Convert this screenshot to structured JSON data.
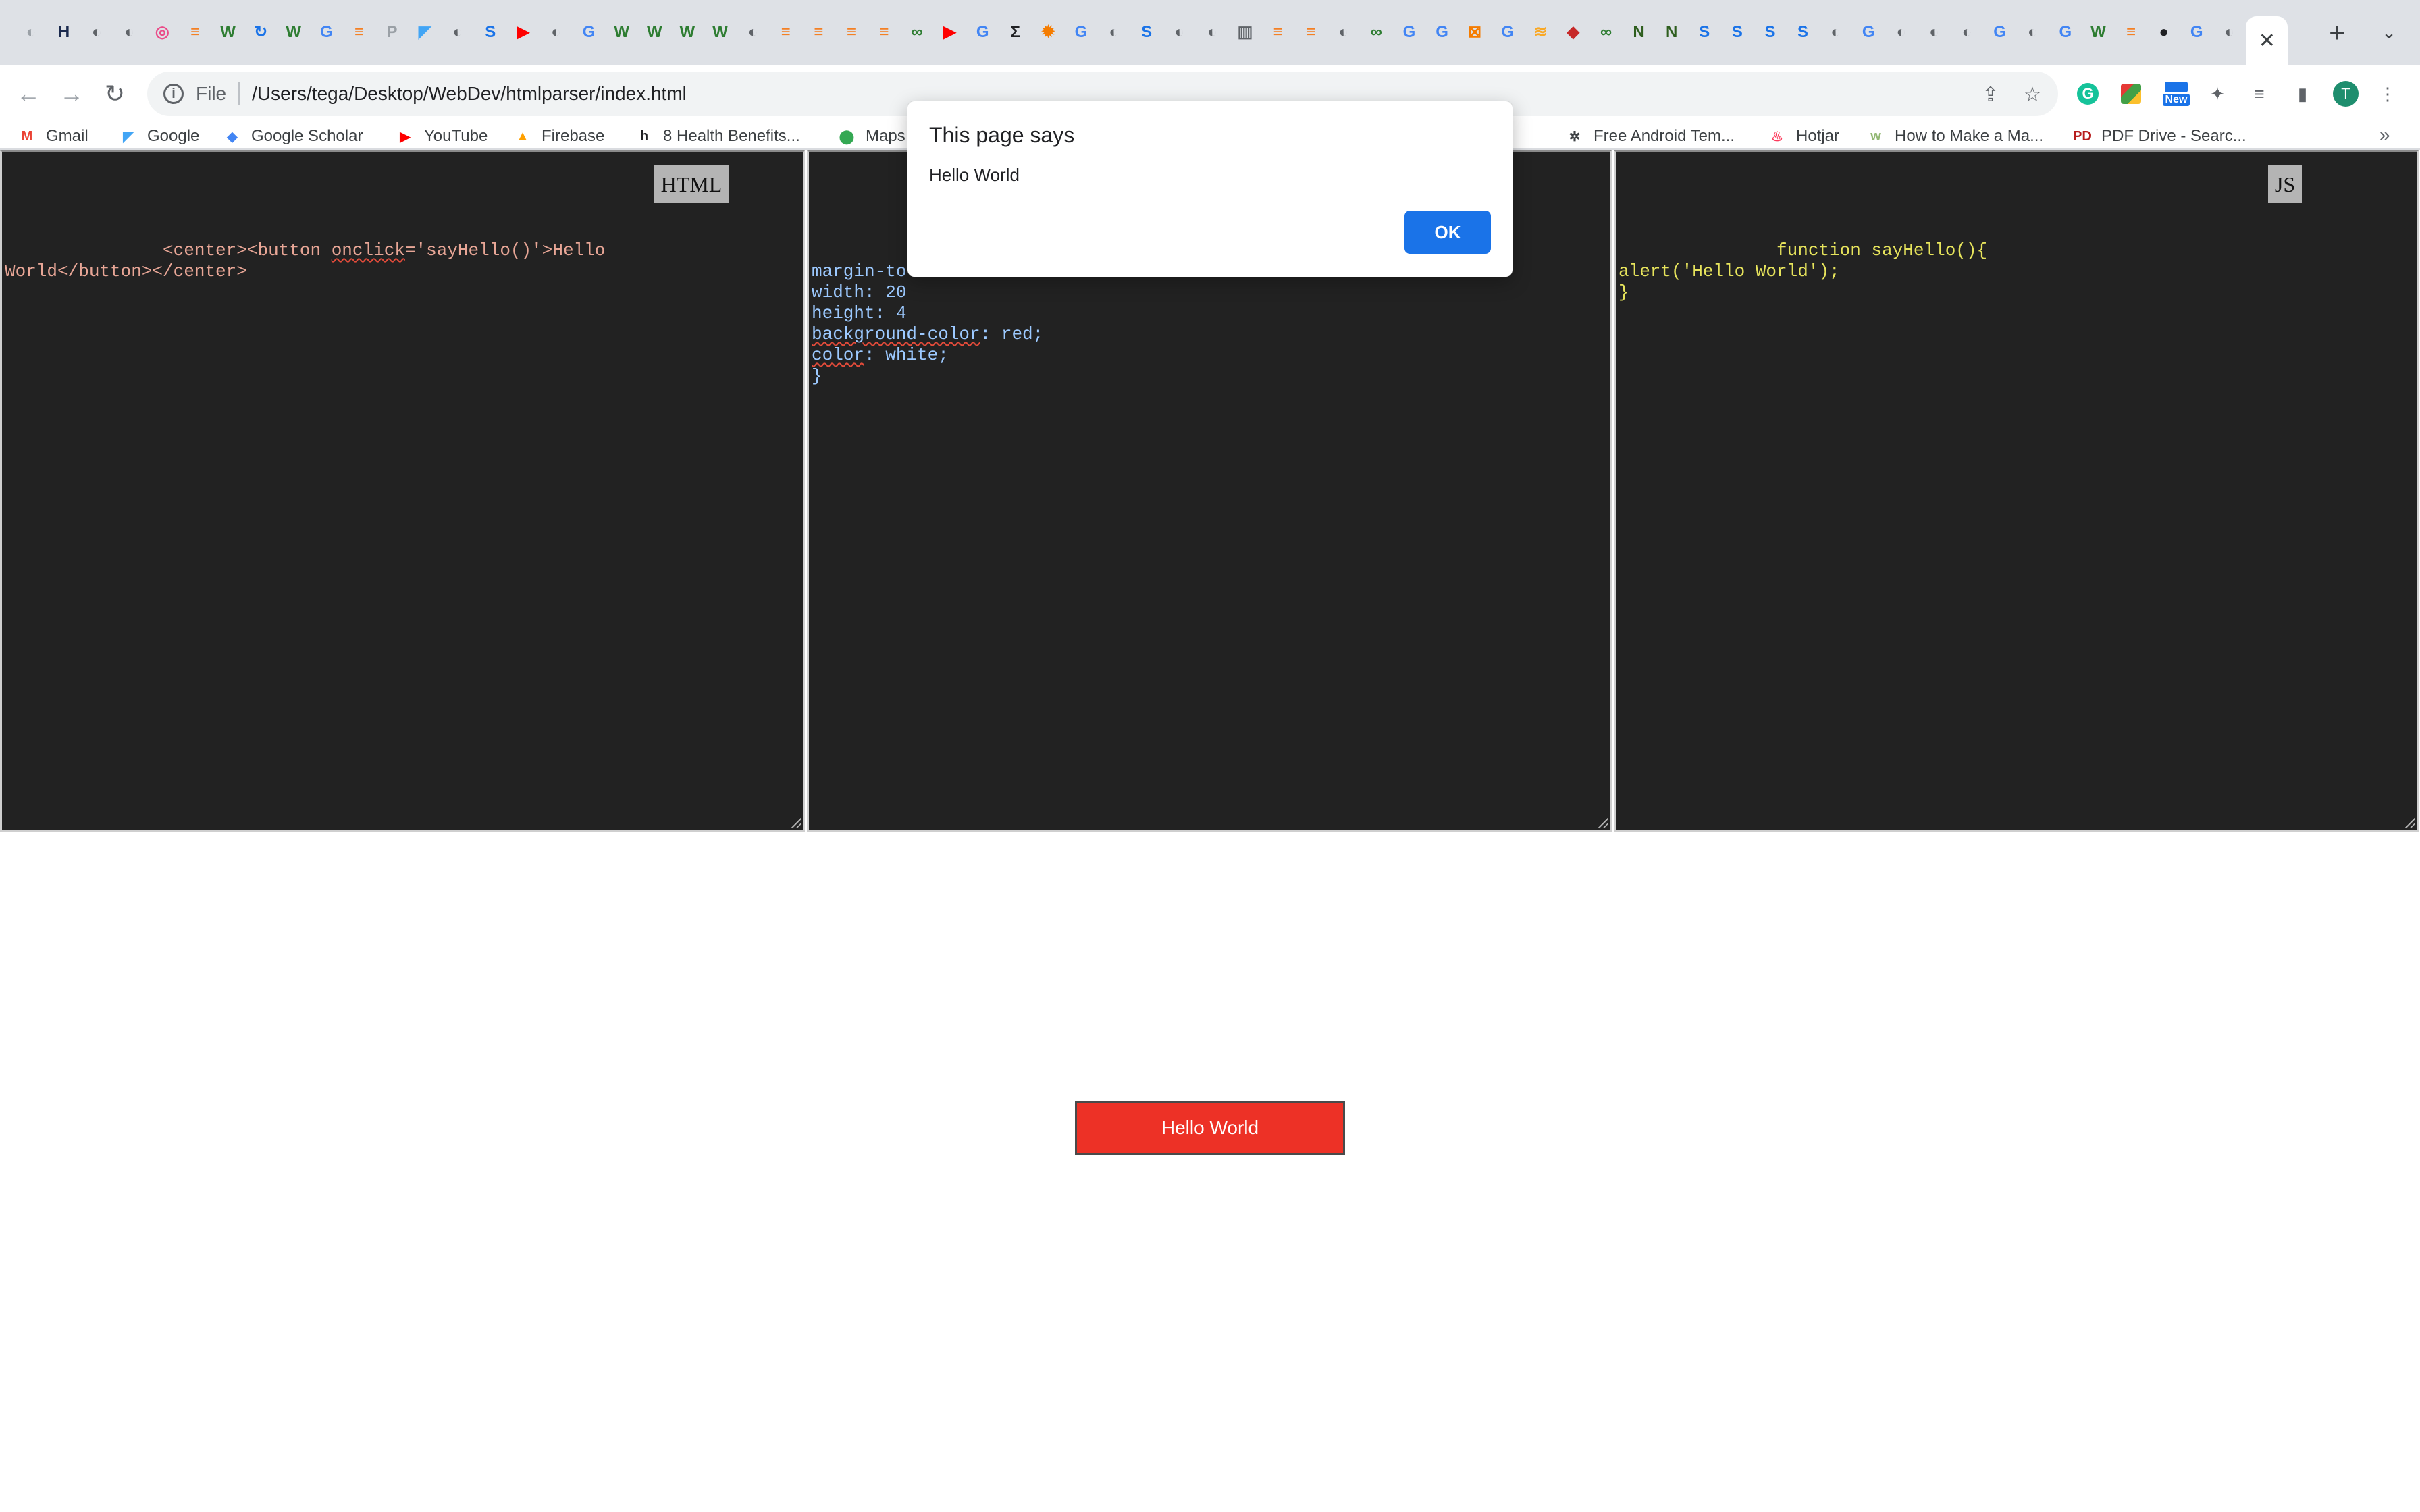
{
  "browser": {
    "active_tab_close": "✕",
    "new_tab": "+",
    "tab_search": "⌄",
    "tab_favicons": [
      {
        "icon": "globe-icon",
        "glyph": "◐",
        "color": "#9aa0a6"
      },
      {
        "icon": "hud-icon",
        "glyph": "H",
        "color": "#1b2a4e"
      },
      {
        "icon": "globe-icon",
        "glyph": "◐",
        "color": "#5f6368"
      },
      {
        "icon": "globe-icon",
        "glyph": "◐",
        "color": "#5f6368"
      },
      {
        "icon": "dribbble-icon",
        "glyph": "◎",
        "color": "#ea4c89"
      },
      {
        "icon": "stackoverflow-icon",
        "glyph": "≡",
        "color": "#f48024"
      },
      {
        "icon": "webflow-icon",
        "glyph": "W",
        "color": "#2e7d32"
      },
      {
        "icon": "refresh-logo-icon",
        "glyph": "↻",
        "color": "#1a73e8"
      },
      {
        "icon": "webflow-icon",
        "glyph": "W",
        "color": "#2e7d32"
      },
      {
        "icon": "google-icon",
        "glyph": "G",
        "color": "#4285f4"
      },
      {
        "icon": "stackoverflow-icon",
        "glyph": "≡",
        "color": "#f48024"
      },
      {
        "icon": "pinterest-icon",
        "glyph": "P",
        "color": "#9aa0a6"
      },
      {
        "icon": "flutter-icon",
        "glyph": "◤",
        "color": "#42a5f5"
      },
      {
        "icon": "globe-icon",
        "glyph": "◐",
        "color": "#5f6368"
      },
      {
        "icon": "s-icon",
        "glyph": "S",
        "color": "#1a73e8"
      },
      {
        "icon": "youtube-icon",
        "glyph": "▶",
        "color": "#ff0000"
      },
      {
        "icon": "globe-icon",
        "glyph": "◐",
        "color": "#5f6368"
      },
      {
        "icon": "google-icon",
        "glyph": "G",
        "color": "#4285f4"
      },
      {
        "icon": "webflow-icon",
        "glyph": "W",
        "color": "#2e7d32"
      },
      {
        "icon": "webflow-icon",
        "glyph": "W",
        "color": "#2e7d32"
      },
      {
        "icon": "webflow-icon",
        "glyph": "W",
        "color": "#2e7d32"
      },
      {
        "icon": "webflow-icon",
        "glyph": "W",
        "color": "#2e7d32"
      },
      {
        "icon": "globe-icon",
        "glyph": "◐",
        "color": "#5f6368"
      },
      {
        "icon": "stackoverflow-icon",
        "glyph": "≡",
        "color": "#f48024"
      },
      {
        "icon": "stackoverflow-icon",
        "glyph": "≡",
        "color": "#f48024"
      },
      {
        "icon": "stackoverflow-icon",
        "glyph": "≡",
        "color": "#f48024"
      },
      {
        "icon": "stackoverflow-icon",
        "glyph": "≡",
        "color": "#f48024"
      },
      {
        "icon": "link-icon",
        "glyph": "∞",
        "color": "#2e7d32"
      },
      {
        "icon": "youtube-icon",
        "glyph": "▶",
        "color": "#ff0000"
      },
      {
        "icon": "google-icon",
        "glyph": "G",
        "color": "#4285f4"
      },
      {
        "icon": "sigma-icon",
        "glyph": "Σ",
        "color": "#202124"
      },
      {
        "icon": "sun-icon",
        "glyph": "✹",
        "color": "#f57c00"
      },
      {
        "icon": "google-icon",
        "glyph": "G",
        "color": "#4285f4"
      },
      {
        "icon": "globe-icon",
        "glyph": "◐",
        "color": "#5f6368"
      },
      {
        "icon": "s-icon",
        "glyph": "S",
        "color": "#1a73e8"
      },
      {
        "icon": "globe-icon",
        "glyph": "◐",
        "color": "#5f6368"
      },
      {
        "icon": "globe-icon",
        "glyph": "◐",
        "color": "#5f6368"
      },
      {
        "icon": "bars-icon",
        "glyph": "▥",
        "color": "#5f6368"
      },
      {
        "icon": "stackoverflow-icon",
        "glyph": "≡",
        "color": "#f48024"
      },
      {
        "icon": "stackoverflow-icon",
        "glyph": "≡",
        "color": "#f48024"
      },
      {
        "icon": "globe-icon",
        "glyph": "◐",
        "color": "#5f6368"
      },
      {
        "icon": "link-icon",
        "glyph": "∞",
        "color": "#2e7d32"
      },
      {
        "icon": "google-icon",
        "glyph": "G",
        "color": "#4285f4"
      },
      {
        "icon": "google-icon",
        "glyph": "G",
        "color": "#4285f4"
      },
      {
        "icon": "draw-icon",
        "glyph": "⊠",
        "color": "#f57c00"
      },
      {
        "icon": "google-icon",
        "glyph": "G",
        "color": "#4285f4"
      },
      {
        "icon": "pma-icon",
        "glyph": "≋",
        "color": "#f9a825"
      },
      {
        "icon": "red-app-icon",
        "glyph": "◆",
        "color": "#c62828"
      },
      {
        "icon": "link-icon",
        "glyph": "∞",
        "color": "#2e7d32"
      },
      {
        "icon": "notion-icon",
        "glyph": "N",
        "color": "#2e5e1e"
      },
      {
        "icon": "notion-icon",
        "glyph": "N",
        "color": "#2e5e1e"
      },
      {
        "icon": "s-icon",
        "glyph": "S",
        "color": "#1a73e8"
      },
      {
        "icon": "s-icon",
        "glyph": "S",
        "color": "#1a73e8"
      },
      {
        "icon": "s-icon",
        "glyph": "S",
        "color": "#1a73e8"
      },
      {
        "icon": "s-icon",
        "glyph": "S",
        "color": "#1a73e8"
      },
      {
        "icon": "globe-icon",
        "glyph": "◐",
        "color": "#5f6368"
      },
      {
        "icon": "google-icon",
        "glyph": "G",
        "color": "#4285f4"
      },
      {
        "icon": "globe-icon",
        "glyph": "◐",
        "color": "#5f6368"
      },
      {
        "icon": "globe-icon",
        "glyph": "◐",
        "color": "#5f6368"
      },
      {
        "icon": "globe-icon",
        "glyph": "◐",
        "color": "#5f6368"
      },
      {
        "icon": "google-icon",
        "glyph": "G",
        "color": "#4285f4"
      },
      {
        "icon": "globe-icon",
        "glyph": "◐",
        "color": "#5f6368"
      },
      {
        "icon": "google-icon",
        "glyph": "G",
        "color": "#4285f4"
      },
      {
        "icon": "webflow-icon",
        "glyph": "W",
        "color": "#2e7d32"
      },
      {
        "icon": "stackoverflow-icon",
        "glyph": "≡",
        "color": "#f48024"
      },
      {
        "icon": "github-icon",
        "glyph": "●",
        "color": "#202124"
      },
      {
        "icon": "google-icon",
        "glyph": "G",
        "color": "#4285f4"
      },
      {
        "icon": "globe-icon",
        "glyph": "◐",
        "color": "#5f6368"
      }
    ],
    "toolbar": {
      "back": "←",
      "forward": "→",
      "reload": "↻",
      "info": "i",
      "scheme": "File",
      "url": "/Users/tega/Desktop/WebDev/htmlparser/index.html",
      "share": "⇪",
      "bookmark_star": "☆",
      "grammarly": "G",
      "ext_new_badge": "New",
      "extensions": "✦",
      "media": "≡",
      "side_panel": "▮",
      "profile": "T",
      "menu": "⋮"
    },
    "bookmarks": [
      {
        "label": "Gmail",
        "icon": "gmail-icon",
        "glyph": "M",
        "color": "#ea4335"
      },
      {
        "label": "Google",
        "icon": "flutter-icon",
        "glyph": "◤",
        "color": "#42a5f5"
      },
      {
        "label": "Google Scholar",
        "icon": "scholar-icon",
        "glyph": "◆",
        "color": "#4285f4"
      },
      {
        "label": "YouTube",
        "icon": "youtube-icon",
        "glyph": "▶",
        "color": "#ff0000"
      },
      {
        "label": "Firebase",
        "icon": "firebase-icon",
        "glyph": "▲",
        "color": "#ffa000"
      },
      {
        "label": "8 Health Benefits...",
        "icon": "health-icon",
        "glyph": "h",
        "color": "#202124"
      },
      {
        "label": "Maps",
        "icon": "maps-icon",
        "glyph": "⬤",
        "color": "#34a853"
      },
      {
        "label": "sign",
        "icon": "",
        "glyph": "",
        "color": "#3c4043"
      },
      {
        "label": "Free Android Tem...",
        "icon": "gear-icon",
        "glyph": "✲",
        "color": "#3c4043"
      },
      {
        "label": "Hotjar",
        "icon": "hotjar-icon",
        "glyph": "♨",
        "color": "#fd3a5c"
      },
      {
        "label": "How to Make a Ma...",
        "icon": "wikihow-icon",
        "glyph": "w",
        "color": "#93b874"
      },
      {
        "label": "PDF Drive - Searc...",
        "icon": "pdf-drive-icon",
        "glyph": "PD",
        "color": "#b71c1c"
      }
    ],
    "bookmarks_overflow": "»"
  },
  "page": {
    "html_label": "HTML",
    "html_code_before": "               <center><button ",
    "html_code_error": "onclick",
    "html_code_after": "='sayHello()'>Hello\nWorld</button></center>",
    "css_lines": [
      {
        "pre": "",
        "err": "",
        "post": "margin-to"
      },
      {
        "pre": "width: 20",
        "err": "",
        "post": ""
      },
      {
        "pre": "height: 4",
        "err": "",
        "post": ""
      },
      {
        "pre": "",
        "err": "background-color",
        "post": ": red;"
      },
      {
        "pre": "",
        "err": "color",
        "post": ": white;"
      },
      {
        "pre": "}",
        "err": "",
        "post": ""
      }
    ],
    "js_label": "JS",
    "js_code": "               function sayHello(){\nalert('Hello World');\n}",
    "preview_button_label": "Hello World",
    "accent_color": "#ed3126"
  },
  "alert": {
    "title": "This page says",
    "message": "Hello World",
    "ok_label": "OK",
    "ok_color": "#1a73e8"
  }
}
